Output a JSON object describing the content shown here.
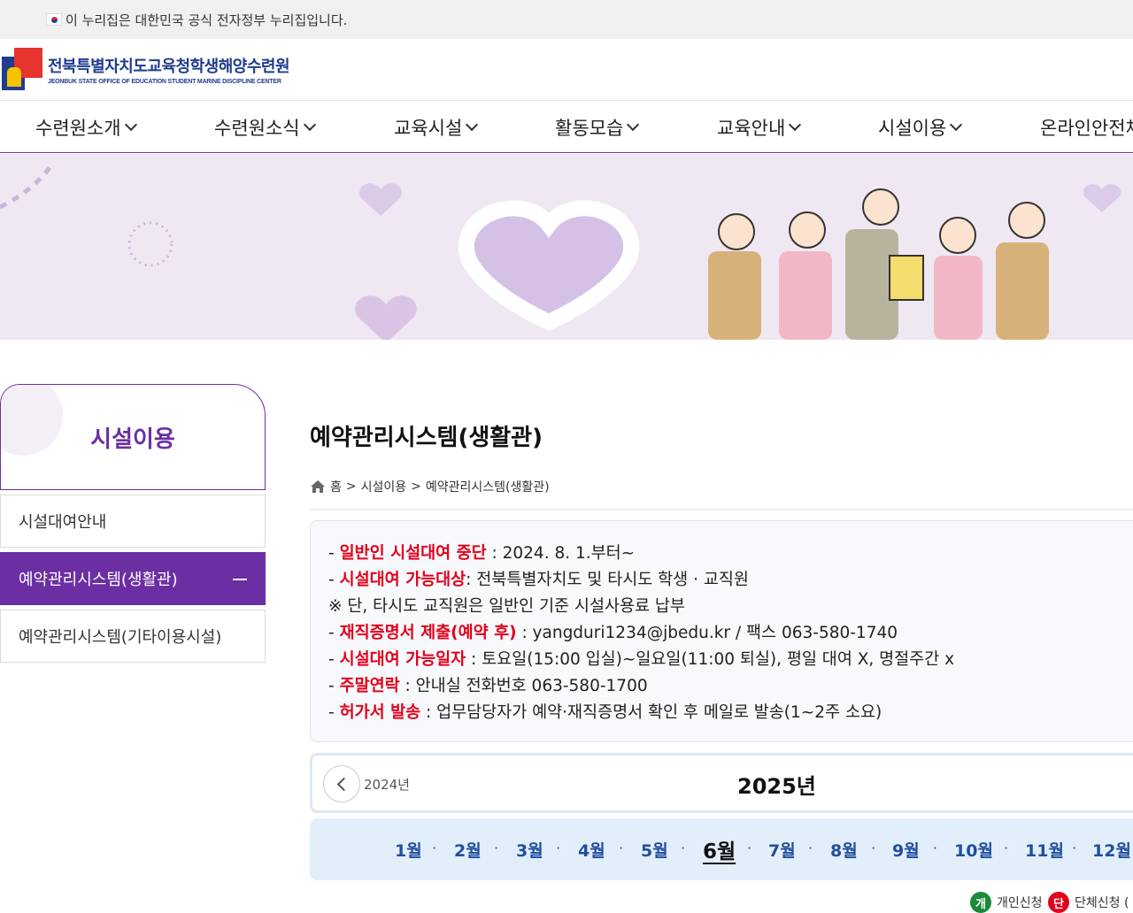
{
  "topbar": {
    "notice": "이 누리집은 대한민국 공식 전자정부 누리집입니다."
  },
  "logo": {
    "title": "전북특별자치도교육청학생해양수련원",
    "subtitle": "JEONBUK STATE OFFICE  OF EDUCATION STUDENT MARINE DISCIPLINE CENTER"
  },
  "gnb": [
    "수련원소개",
    "수련원소식",
    "교육시설",
    "활동모습",
    "교육안내",
    "시설이용",
    "온라인안전체"
  ],
  "sidebar": {
    "title": "시설이용",
    "items": [
      {
        "label": "시설대여안내"
      },
      {
        "label": "예약관리시스템(생활관)"
      },
      {
        "label": "예약관리시스템(기타이용시설)"
      }
    ]
  },
  "main": {
    "title": "예약관리시스템(생활관)",
    "breadcrumb": {
      "home": "홈",
      "sep1": ">",
      "level1": "시설이용",
      "sep2": ">",
      "level2": "예약관리시스템(생활관)"
    }
  },
  "info": [
    {
      "prefix": "- ",
      "highlight": "일반인 시설대여 중단",
      "rest": " : 2024. 8. 1.부터~"
    },
    {
      "prefix": "- ",
      "highlight": "시설대여 가능대상",
      "rest": ": 전북특별자치도 및 타시도 학생 · 교직원"
    },
    {
      "prefix": "※ 단, 타시도 교직원은 일반인 기준 시설사용료 납부",
      "highlight": "",
      "rest": ""
    },
    {
      "prefix": "- ",
      "highlight": "재직증명서 제출(예약 후)",
      "rest": " : yangduri1234@jbedu.kr / 팩스 063-580-1740"
    },
    {
      "prefix": "- ",
      "highlight": "시설대여 가능일자",
      "rest": " : 토요일(15:00 입실)~일요일(11:00 퇴실), 평일 대여 X, 명절주간 x"
    },
    {
      "prefix": "- ",
      "highlight": "주말연락",
      "rest": " : 안내실 전화번호 063-580-1700"
    },
    {
      "prefix": "- ",
      "highlight": "허가서 발송",
      "rest": " : 업무담당자가 예약·재직증명서 확인 후 메일로 발송(1~2주 소요)"
    }
  ],
  "calendar": {
    "prev_year": "2024년",
    "year": "2025년",
    "months": [
      "1월",
      "2월",
      "3월",
      "4월",
      "5월",
      "6월",
      "7월",
      "8월",
      "9월",
      "10월",
      "11월",
      "12월"
    ],
    "current_month": "6월",
    "separator": "·"
  },
  "legend": [
    {
      "badge": "개",
      "label": "개인신청",
      "color": "#1a8a3a"
    },
    {
      "badge": "단",
      "label": "단체신청 (",
      "color": "#e3001b"
    }
  ]
}
